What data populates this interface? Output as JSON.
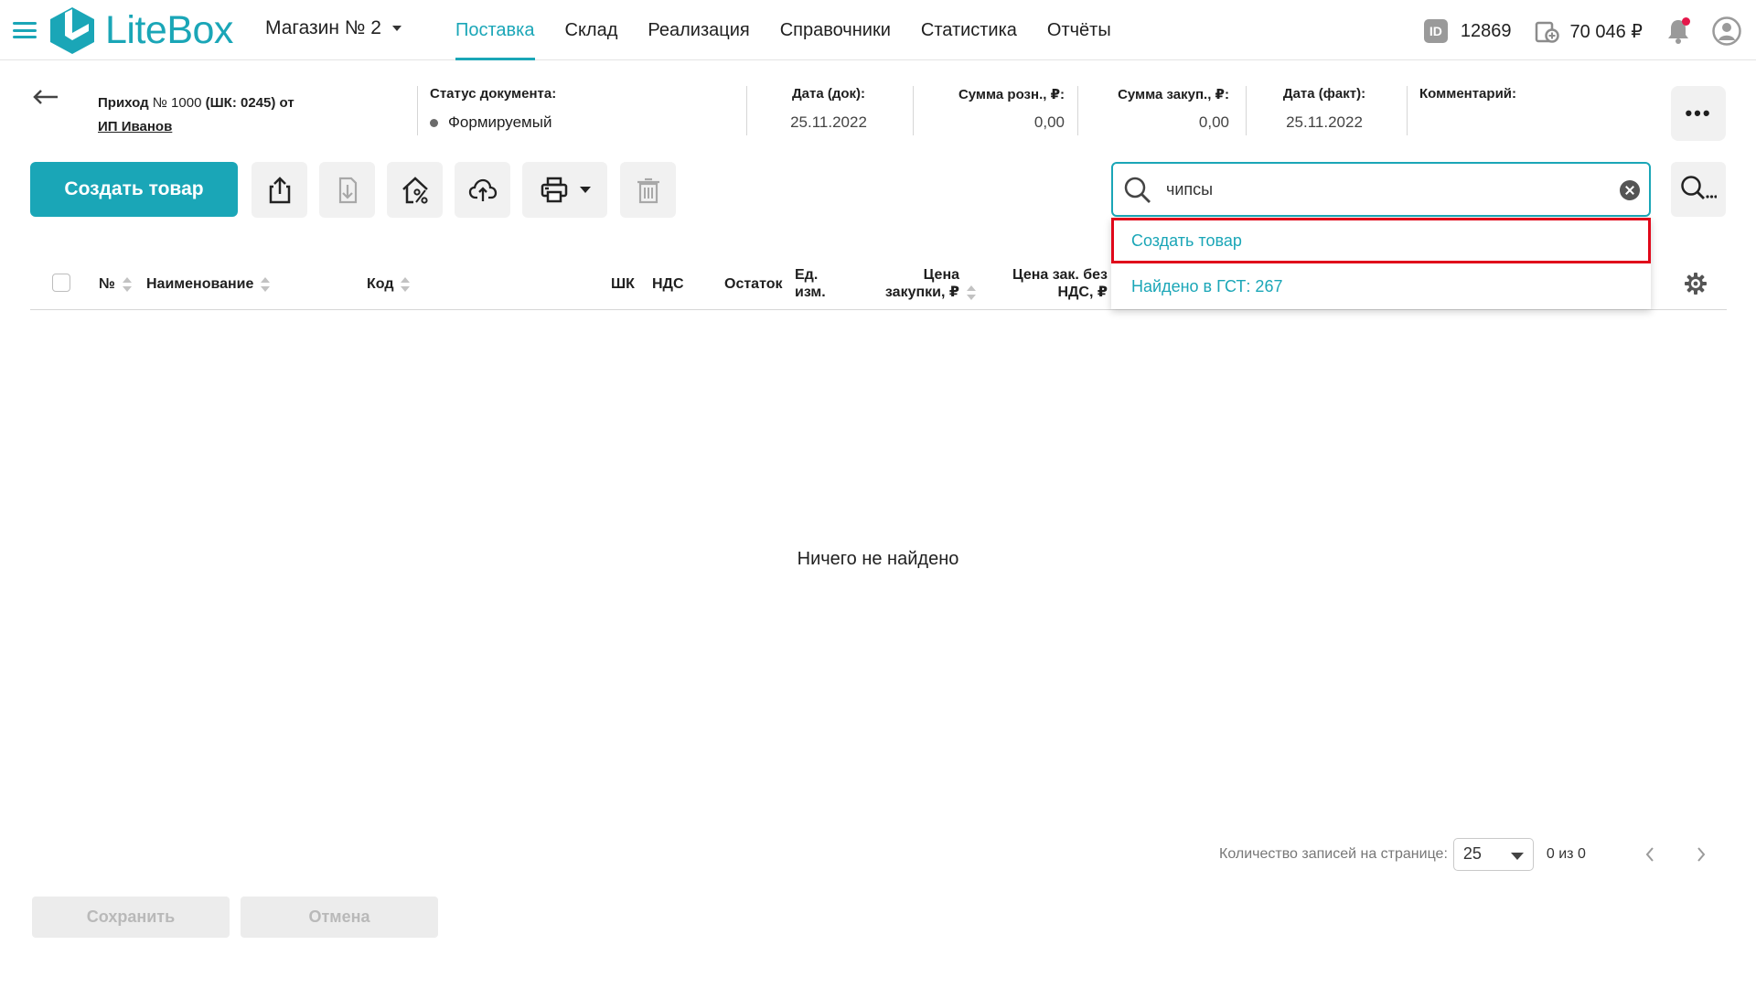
{
  "app": {
    "brand": "LiteBox",
    "store": "Магазин № 2",
    "account_id": "12869",
    "balance": "70 046 ₽"
  },
  "nav": [
    {
      "label": "Поставка",
      "active": true
    },
    {
      "label": "Склад",
      "active": false
    },
    {
      "label": "Реализация",
      "active": false
    },
    {
      "label": "Справочники",
      "active": false
    },
    {
      "label": "Статистика",
      "active": false
    },
    {
      "label": "Отчёты",
      "active": false
    }
  ],
  "doc": {
    "title_bold": "Приход",
    "title_no": "№ 1000",
    "title_barcode": "(ШК: 0245)",
    "title_from": "от",
    "supplier": "ИП Иванов",
    "status_label": "Статус документа:",
    "status_value": "Формируемый",
    "date_doc_label": "Дата (док):",
    "date_doc_value": "25.11.2022",
    "sum_retail_label": "Сумма розн., ₽:",
    "sum_retail_value": "0,00",
    "sum_purchase_label": "Сумма закуп., ₽:",
    "sum_purchase_value": "0,00",
    "date_fact_label": "Дата (факт):",
    "date_fact_value": "25.11.2022",
    "comment_label": "Комментарий:",
    "more_label": "•••"
  },
  "toolbar": {
    "create_label": "Создать товар",
    "icons": [
      "export-icon",
      "import-icon",
      "discount-icon",
      "cloud-upload-icon",
      "printer-icon",
      "trash-icon"
    ]
  },
  "search": {
    "value": "чипсы",
    "placeholder": ""
  },
  "dropdown": [
    {
      "label": "Создать товар",
      "highlighted": true
    },
    {
      "label": "Найдено в ГСТ: 267",
      "highlighted": false
    }
  ],
  "table": {
    "columns": {
      "num": "№",
      "name": "Наименование",
      "code": "Код",
      "barcode": "ШК",
      "vat": "НДС",
      "stock": "Остаток",
      "unit_1": "Ед.",
      "unit_2": "изм.",
      "price_1": "Цена",
      "price_2": "закупки, ₽",
      "price_novat_1": "Цена зак. без",
      "price_novat_2": "НДС, ₽"
    },
    "empty_text": "Ничего не найдено"
  },
  "pager": {
    "label": "Количество записей на странице:",
    "page_size": "25",
    "range": "0 из 0"
  },
  "footer": {
    "save_label": "Сохранить",
    "cancel_label": "Отмена"
  },
  "colors": {
    "accent": "#1aa6b7",
    "highlight_border": "#e0081a",
    "notification": "#e5174a"
  }
}
